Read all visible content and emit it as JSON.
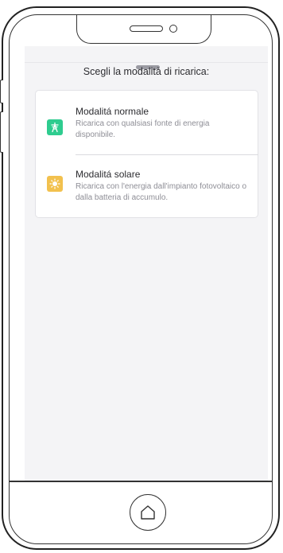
{
  "sheet": {
    "title": "Scegli la modalità di ricarica:"
  },
  "options": [
    {
      "title": "Modalitá normale",
      "description": "Ricarica con qualsiasi fonte di energia disponibile.",
      "icon": "power-pylon-icon",
      "icon_color": "#2ecc8f"
    },
    {
      "title": "Modalitá solare",
      "description": "Ricarica con l'energia dall'impianto fotovoltaico o dalla batteria di accumulo.",
      "icon": "sun-icon",
      "icon_color": "#f2c14e"
    }
  ],
  "device": {
    "home_icon": "home-icon"
  }
}
